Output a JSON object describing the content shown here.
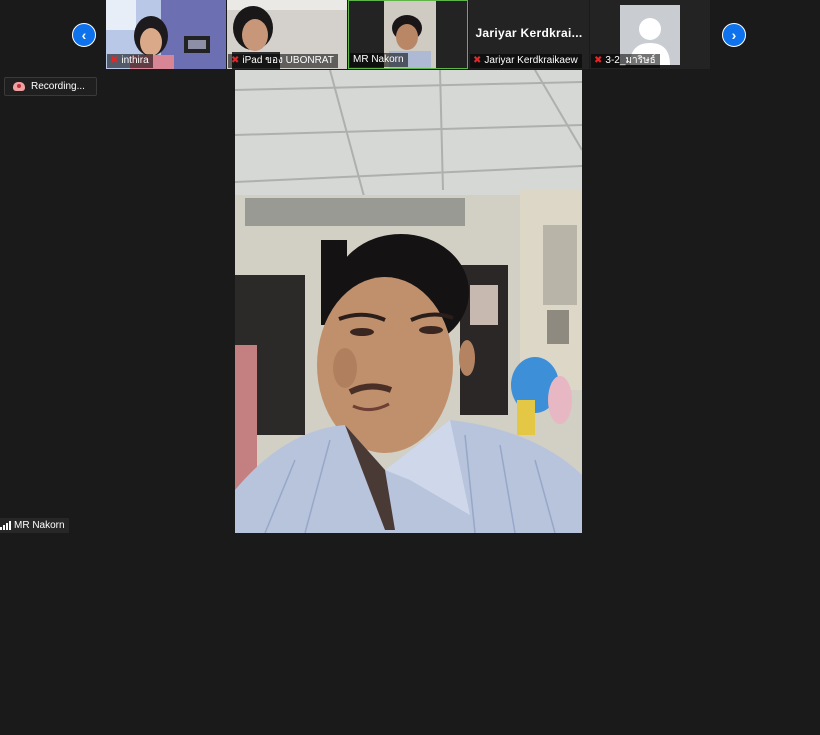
{
  "strip": {
    "prev_icon": "chevron-left-icon",
    "next_icon": "chevron-right-icon",
    "participants": [
      {
        "label": "inthira"
      },
      {
        "label": "iPad ของ UBONRAT"
      },
      {
        "label": "MR Nakorn"
      },
      {
        "label": "Jariyar Kerdkraikaew",
        "display_name": "Jariyar  Kerdkrai..."
      },
      {
        "label": "3-2_มาริษธ์"
      }
    ]
  },
  "recording": {
    "label": "Recording..."
  },
  "active_speaker": {
    "label": "MR Nakorn"
  },
  "colors": {
    "accent": "#0e72ed",
    "active_border": "#5fb547",
    "muted": "#e02828"
  }
}
